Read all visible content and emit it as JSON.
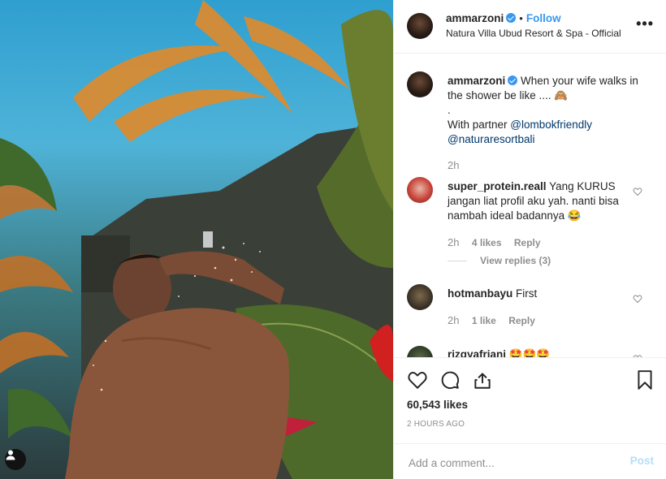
{
  "post": {
    "author": {
      "username": "ammarzoni",
      "verified": true,
      "follow_label": "Follow",
      "separator": "•"
    },
    "location": "Natura Villa Ubud Resort & Spa - Official",
    "more_icon": "more-options-icon",
    "caption": {
      "username": "ammarzoni",
      "text_line1": "When your wife walks in the shower be like .... 🙈",
      "text_dot": ".",
      "partner_prefix": "With partner",
      "mention1": "@lombokfriendly",
      "mention2": "@naturaresortbali",
      "time": "2h"
    },
    "comments": [
      {
        "username": "super_protein.reall",
        "text": "Yang KURUS jangan liat profil aku yah. nanti bisa nambah ideal badannya 😂",
        "time": "2h",
        "likes": "4 likes",
        "reply": "Reply",
        "view_replies": "View replies (3)"
      },
      {
        "username": "hotmanbayu",
        "text": "First",
        "time": "2h",
        "likes": "1 like",
        "reply": "Reply"
      },
      {
        "username": "rizgyafriani",
        "text": "🤩🤩🤩"
      }
    ],
    "likes_count": "60,543 likes",
    "time_ago": "2 HOURS AGO",
    "add_comment_placeholder": "Add a comment...",
    "post_button": "Post"
  },
  "colors": {
    "accent": "#3897f0",
    "text": "#262626",
    "muted": "#8e8e8e",
    "post_disabled": "#b2dffc"
  }
}
